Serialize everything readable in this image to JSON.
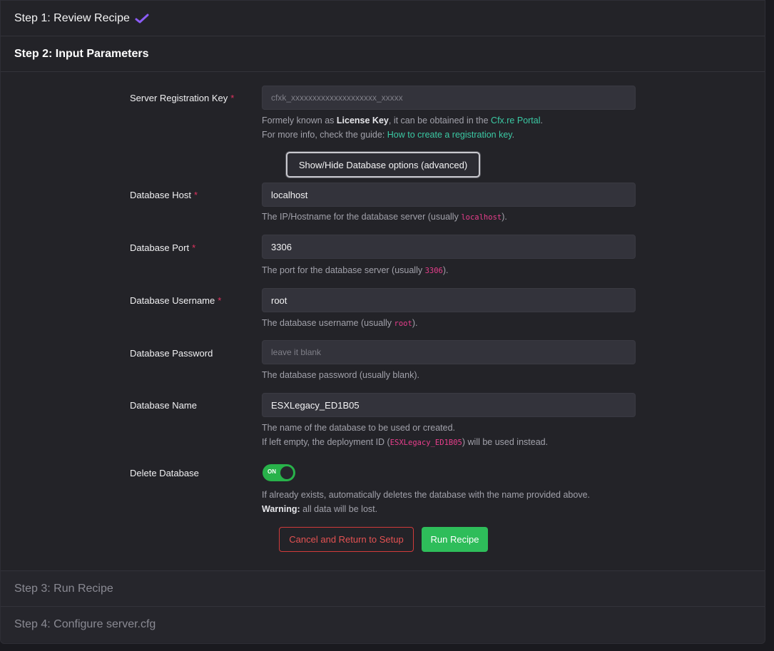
{
  "steps": {
    "step1": "Step 1: Review Recipe",
    "step2": "Step 2: Input Parameters",
    "step3": "Step 3: Run Recipe",
    "step4": "Step 4: Configure server.cfg"
  },
  "colors": {
    "accent_green": "#2ebd5a",
    "danger": "#d13b3b",
    "link": "#3bc9a4",
    "check": "#8b5cf6"
  },
  "fields": {
    "registration_key": {
      "label": "Server Registration Key",
      "required": "*",
      "placeholder": "cfxk_xxxxxxxxxxxxxxxxxxxx_xxxxx",
      "help_line1_pre": "Formely known as ",
      "help_line1_bold": "License Key",
      "help_line1_mid": ", it can be obtained in the ",
      "help_line1_link": "Cfx.re Portal",
      "help_line1_post": ".",
      "help_line2_pre": "For more info, check the guide: ",
      "help_line2_link": "How to create a registration key",
      "help_line2_post": "."
    },
    "db_toggle_button": "Show/Hide Database options (advanced)",
    "db_host": {
      "label": "Database Host",
      "required": "*",
      "value": "localhost",
      "help_pre": "The IP/Hostname for the database server (usually ",
      "help_code": "localhost",
      "help_post": ")."
    },
    "db_port": {
      "label": "Database Port",
      "required": "*",
      "value": "3306",
      "help_pre": "The port for the database server (usually ",
      "help_code": "3306",
      "help_post": ")."
    },
    "db_username": {
      "label": "Database Username",
      "required": "*",
      "value": "root",
      "help_pre": "The database username (usually ",
      "help_code": "root",
      "help_post": ")."
    },
    "db_password": {
      "label": "Database Password",
      "placeholder": "leave it blank",
      "help": "The database password (usually blank)."
    },
    "db_name": {
      "label": "Database Name",
      "value": "ESXLegacy_ED1B05",
      "help_line1": "The name of the database to be used or created.",
      "help_line2_pre": "If left empty, the deployment ID (",
      "help_line2_code": "ESXLegacy_ED1B05",
      "help_line2_post": ") will be used instead."
    },
    "delete_db": {
      "label": "Delete Database",
      "switch_text": "ON",
      "help_line1": "If already exists, automatically deletes the database with the name provided above.",
      "help_line2_bold": "Warning:",
      "help_line2_rest": " all data will be lost."
    }
  },
  "actions": {
    "cancel": "Cancel and Return to Setup",
    "run": "Run Recipe"
  }
}
